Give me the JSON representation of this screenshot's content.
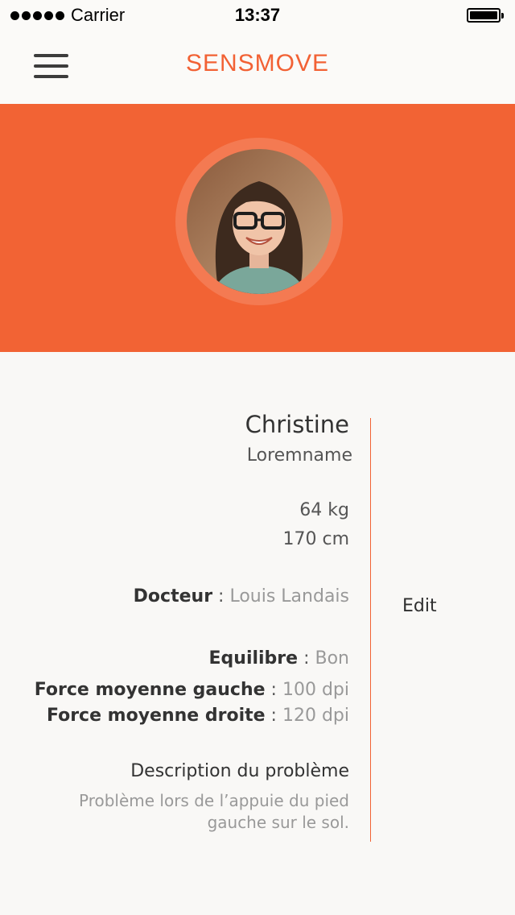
{
  "status_bar": {
    "carrier": "Carrier",
    "time": "13:37"
  },
  "navbar": {
    "title": "SENSMOVE"
  },
  "profile": {
    "first_name": "Christine",
    "last_name": "Loremname",
    "weight": "64 kg",
    "height": "170 cm",
    "doctor_label": "Docteur",
    "doctor_value": "Louis Landais",
    "balance_label": "Equilibre",
    "balance_value": "Bon",
    "force_left_label": "Force moyenne gauche",
    "force_left_value": "100 dpi",
    "force_right_label": "Force moyenne droite",
    "force_right_value": "120 dpi",
    "description_title": "Description du problème",
    "description_line1": "Problème lors de l’appuie du pied",
    "description_line2": "gauche sur le sol."
  },
  "actions": {
    "edit_label": "Edit"
  },
  "colors": {
    "accent": "#f26334",
    "brand": "#f26134",
    "background": "#f9f8f6"
  }
}
